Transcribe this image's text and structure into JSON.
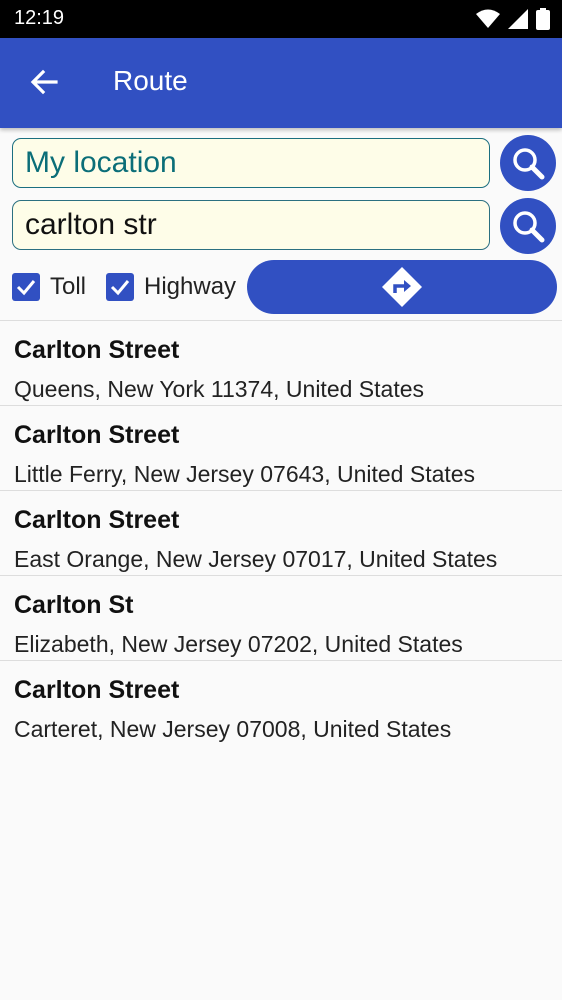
{
  "status_bar": {
    "time": "12:19"
  },
  "app_bar": {
    "title": "Route",
    "back_icon": "arrow-left-icon"
  },
  "route_form": {
    "from_value": "My location",
    "to_value": "carlton str",
    "toll_label": "Toll",
    "toll_checked": true,
    "highway_label": "Highway",
    "highway_checked": true
  },
  "results": [
    {
      "name": "Carlton Street",
      "address": "Queens, New York 11374, United States"
    },
    {
      "name": "Carlton Street",
      "address": "Little Ferry, New Jersey 07643, United States"
    },
    {
      "name": "Carlton Street",
      "address": "East Orange, New Jersey 07017, United States"
    },
    {
      "name": "Carlton St",
      "address": "Elizabeth, New Jersey 07202, United States"
    },
    {
      "name": "Carlton Street",
      "address": "Carteret, New Jersey 07008, United States"
    }
  ],
  "colors": {
    "primary": "#3150c2",
    "field_bg": "#fefde8",
    "field_border": "#1b6f80"
  }
}
